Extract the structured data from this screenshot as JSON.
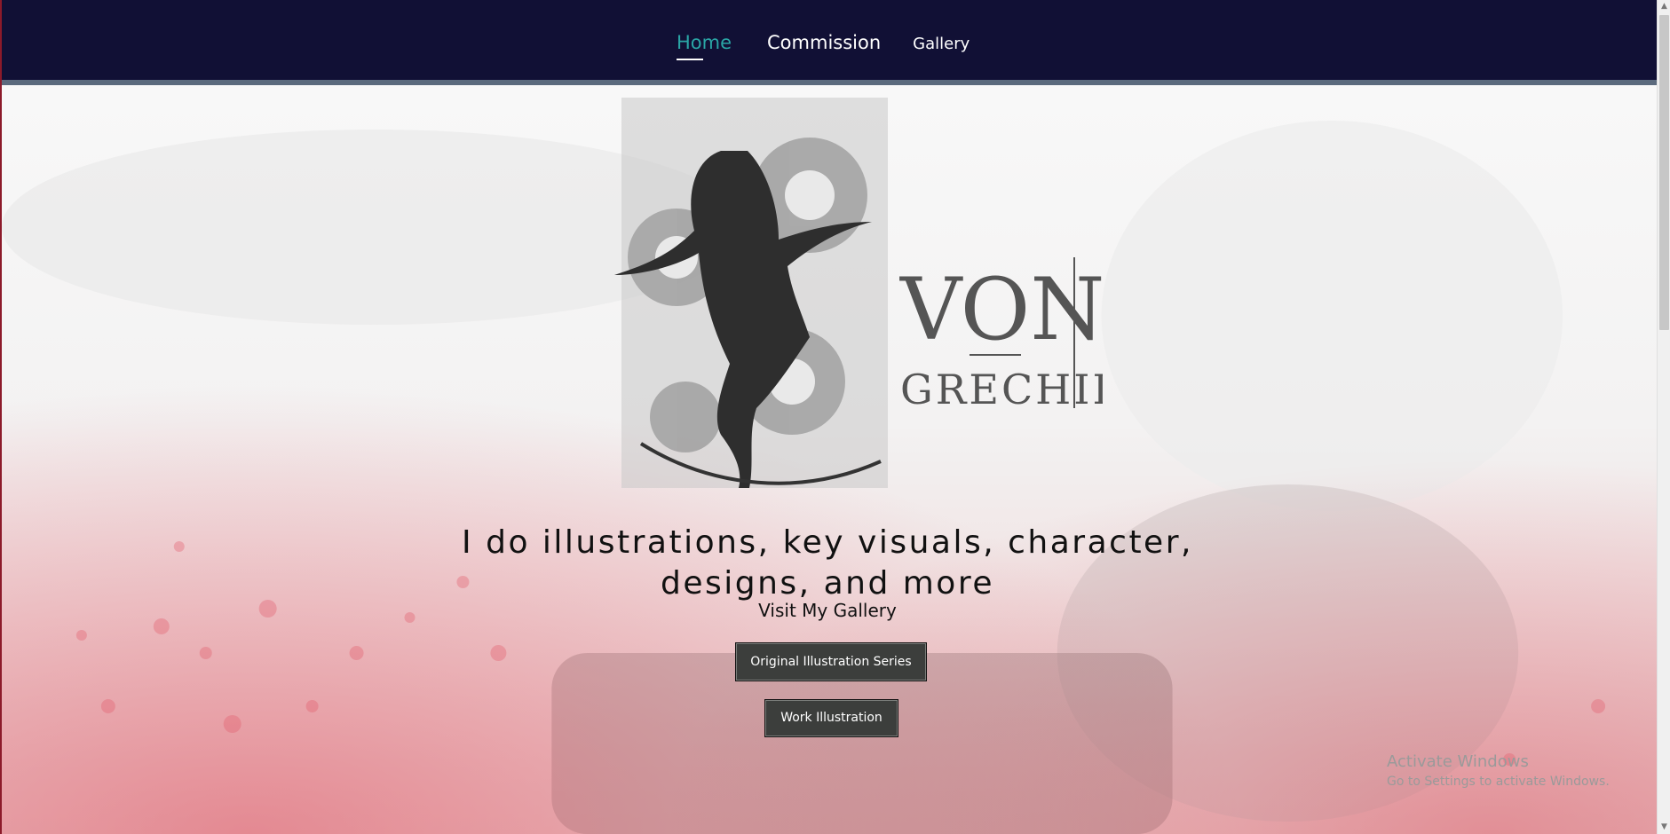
{
  "nav": {
    "items": [
      {
        "label": "Home"
      },
      {
        "label": "Commission"
      },
      {
        "label": "Gallery"
      }
    ]
  },
  "logo": {
    "line1": "VON",
    "line2": "GRECHII"
  },
  "hero": {
    "tagline_line1": "I do illustrations, key visuals, character,",
    "tagline_line2": "designs, and more",
    "visit_label": "Visit  My Gallery",
    "buttons": [
      {
        "label": "Original Illustration Series"
      },
      {
        "label": "Work Illustration"
      }
    ]
  },
  "watermark": {
    "line1": "Activate Windows",
    "line2": "Go to Settings to activate Windows."
  },
  "colors": {
    "header_bg": "#111035",
    "active_nav": "#2aa6a6",
    "button_bg": "#3c3e3c"
  }
}
